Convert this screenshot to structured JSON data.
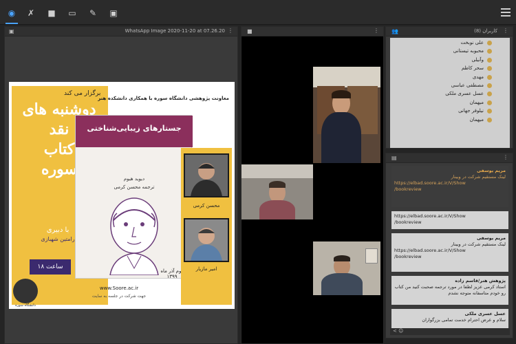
{
  "topbar": {
    "tools": [
      {
        "name": "audio-icon",
        "glyph": "🔊"
      },
      {
        "name": "mic-off-icon",
        "glyph": "🎙"
      },
      {
        "name": "camera-icon",
        "glyph": "■"
      },
      {
        "name": "screen-share-icon",
        "glyph": "▭"
      },
      {
        "name": "brush-icon",
        "glyph": "✎"
      },
      {
        "name": "media-icon",
        "glyph": "▣"
      }
    ]
  },
  "presentation": {
    "filename": "WhatsApp Image 2020-11-20 at 07.26.20",
    "poster": {
      "top_label": "برگزار می کند",
      "header": "معاونت پژوهشی دانشگاه سوره با همکاری دانشکده هنر",
      "title_lines": [
        "دوشنبه های",
        "نقد",
        "کتاب",
        "سوره"
      ],
      "host_label": "با دبیری",
      "host_name": "رامتین شهبازی",
      "time": "ساعت ۱۸",
      "book_title": "جستارهای زیبایی‌شناختی",
      "book_author": "دیوید هیوم",
      "book_translator": "ترجمه محسن کرمی",
      "date": "دوم آذر ماه ۱۳۹۹",
      "speaker1": "محسن کرمی",
      "speaker2": "امیر مازیار",
      "site": "www.Soore.ac.ir",
      "site_note": "جهت شرکت در جلسه به سایت",
      "logo_text": "دانشگاه سوره"
    }
  },
  "users": {
    "header": "کاربران (8)",
    "list": [
      "علی نوبخت",
      "محبوبه تیستانی",
      "وآنیلی",
      "سحر کاظم",
      "مهدی",
      "مصطفی عباسی",
      "عسل عسری ملکی",
      "میهمان",
      "نیلوفر جهانی",
      "میهمان"
    ]
  },
  "chat": {
    "messages": [
      {
        "author": "مریم یوسفی",
        "text": "لینک مستقیم شرکت در وبینار",
        "link": "https://elbad.soore.ac.ir/V/Show",
        "link2": "/bookreview",
        "highlight": true
      },
      {
        "author": "",
        "text": "",
        "link": "https://elbad.soore.ac.ir/V/Show",
        "link2": "/bookreview",
        "highlight": false
      },
      {
        "author": "مریم یوسفی",
        "text": "لینک مستقیم شرکت در وبینار",
        "link": "https://elbad.soore.ac.ir/V/Show",
        "link2": "/bookreview",
        "highlight": false
      },
      {
        "author": "پژوهش هنر/قاسم زاده",
        "text": "استاد کرمی عزیز لطفا در مورد ترجمه صحبت کنید من کتاب رو خودم متاسفانه متوجه نشدم",
        "link": "",
        "link2": "",
        "highlight": false
      },
      {
        "author": "عسل عسری ملکی",
        "text": "سلام و عرض احترام خدمت تمامی بزرگواران",
        "link": "",
        "link2": "",
        "highlight": false
      }
    ],
    "input_hint": "< ☺"
  }
}
